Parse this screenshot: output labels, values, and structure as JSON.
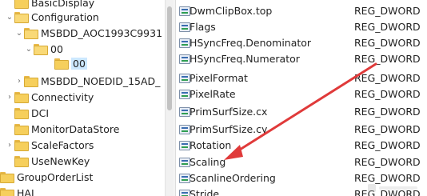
{
  "tree": {
    "items": [
      {
        "label": "BasicDisplay",
        "expanded": false
      },
      {
        "label": "Configuration",
        "expanded": true
      },
      {
        "label": "MSBDD_AOC1993C9931",
        "expanded": true
      },
      {
        "label": "00",
        "expanded": true
      },
      {
        "label": "00",
        "selected": true
      },
      {
        "label": "MSBDD_NOEDID_15AD_",
        "expanded": false
      },
      {
        "label": "Connectivity",
        "expanded": false
      },
      {
        "label": "DCI"
      },
      {
        "label": "MonitorDataStore"
      },
      {
        "label": "ScaleFactors",
        "expanded": false
      },
      {
        "label": "UseNewKey"
      },
      {
        "label": "GroupOrderList"
      },
      {
        "label": "HAL"
      }
    ]
  },
  "values": {
    "rows": [
      {
        "name": "DwmClipBox.top",
        "type": "REG_DWORD"
      },
      {
        "name": "Flags",
        "type": "REG_DWORD"
      },
      {
        "name": "HSyncFreq.Denominator",
        "type": "REG_DWORD"
      },
      {
        "name": "HSyncFreq.Numerator",
        "type": "REG_DWORD"
      },
      {
        "name": "PixelFormat",
        "type": "REG_DWORD"
      },
      {
        "name": "PixelRate",
        "type": "REG_DWORD"
      },
      {
        "name": "PrimSurfSize.cx",
        "type": "REG_DWORD"
      },
      {
        "name": "PrimSurfSize.cy",
        "type": "REG_DWORD"
      },
      {
        "name": "Rotation",
        "type": "REG_DWORD"
      },
      {
        "name": "Scaling",
        "type": "REG_DWORD"
      },
      {
        "name": "ScanlineOrdering",
        "type": "REG_DWORD"
      },
      {
        "name": "Stride",
        "type": "REG_DWORD"
      }
    ]
  },
  "annotation": {
    "color": "#e03a3a"
  }
}
